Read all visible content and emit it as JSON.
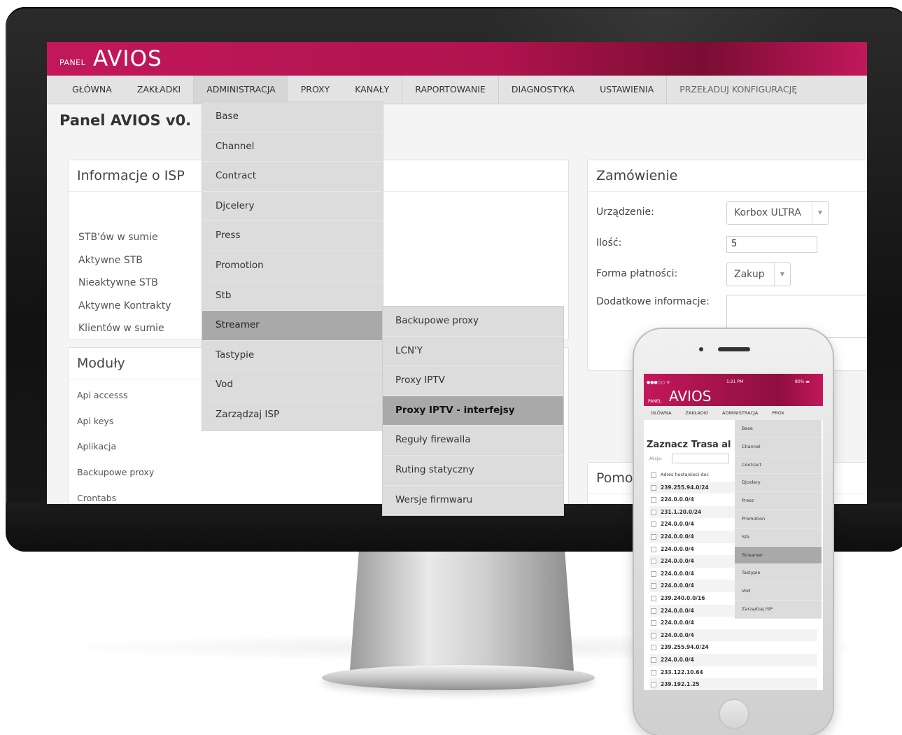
{
  "app": {
    "logo_small": "PANEL",
    "logo_big": "AVIOS",
    "page_title": "Panel AVIOS v0.",
    "brand_color": "#c2185b"
  },
  "nav": {
    "items": [
      "GŁÓWNA",
      "ZAKŁADKI",
      "ADMINISTRACJA",
      "PROXY",
      "KANAŁY",
      "RAPORTOWANIE",
      "DIAGNOSTYKA",
      "USTAWIENIA",
      "PRZEŁADUJ KONFIGURACJĘ"
    ],
    "active": "ADMINISTRACJA"
  },
  "admin_menu": {
    "items": [
      "Base",
      "Channel",
      "Contract",
      "Djcelery",
      "Press",
      "Promotion",
      "Stb",
      "Streamer",
      "Tastypie",
      "Vod",
      "Zarządzaj ISP"
    ],
    "active": "Streamer"
  },
  "streamer_submenu": {
    "items": [
      "Backupowe proxy",
      "LCN'Y",
      "Proxy IPTV",
      "Proxy IPTV - interfejsy",
      "Reguły firewalla",
      "Ruting statyczny",
      "Wersje firmwaru"
    ],
    "active": "Proxy IPTV - interfejsy"
  },
  "isp_panel": {
    "title": "Informacje o ISP",
    "rows": [
      "STB'ów w sumie",
      "Aktywne STB",
      "Nieaktywne STB",
      "Aktywne Kontrakty",
      "Klientów w sumie"
    ]
  },
  "modules_panel": {
    "title": "Moduły",
    "rows": [
      "Api accesss",
      "Api keys",
      "Aplikacja",
      "Backupowe proxy",
      "Crontabs"
    ]
  },
  "order_panel": {
    "title": "Zamówienie",
    "device_label": "Urządzenie:",
    "device_value": "Korbox ULTRA",
    "qty_label": "Ilość:",
    "qty_value": "5",
    "payment_label": "Forma płatności:",
    "payment_value": "Zakup",
    "info_label": "Dodatkowe informacje:"
  },
  "help_panel": {
    "title": "Pomo"
  },
  "phone": {
    "status_left": "●●●○○ ᯤ",
    "status_time": "1:21 PM",
    "status_battery": "80% ▬",
    "logo_small": "PANEL",
    "logo_big": "AVIOS",
    "nav": [
      "GŁÓWNA",
      "ZAKŁADKI",
      "ADMINISTRACJA",
      "PROX"
    ],
    "title": "Zaznacz Trasa al",
    "search_label": "Akcje:",
    "table_header": "Adres hosta/sieci doc",
    "routes": [
      "239.255.94.0/24",
      "224.0.0.0/4",
      "231.1.20.0/24",
      "224.0.0.0/4",
      "224.0.0.0/4",
      "224.0.0.0/4",
      "224.0.0.0/4",
      "224.0.0.0/4",
      "224.0.0.0/4",
      "239.240.0.0/16",
      "224.0.0.0/4",
      "224.0.0.0/4",
      "224.0.0.0/4",
      "239.255.94.0/24",
      "224.0.0.0/4",
      "233.122.10.64",
      "239.192.1.25"
    ],
    "menu": [
      "Base",
      "Channel",
      "Contract",
      "Djcelery",
      "Press",
      "Promotion",
      "Stb",
      "Streamer",
      "Tastypie",
      "Vod",
      "Zarządzaj ISP"
    ],
    "menu_active": "Streamer"
  }
}
